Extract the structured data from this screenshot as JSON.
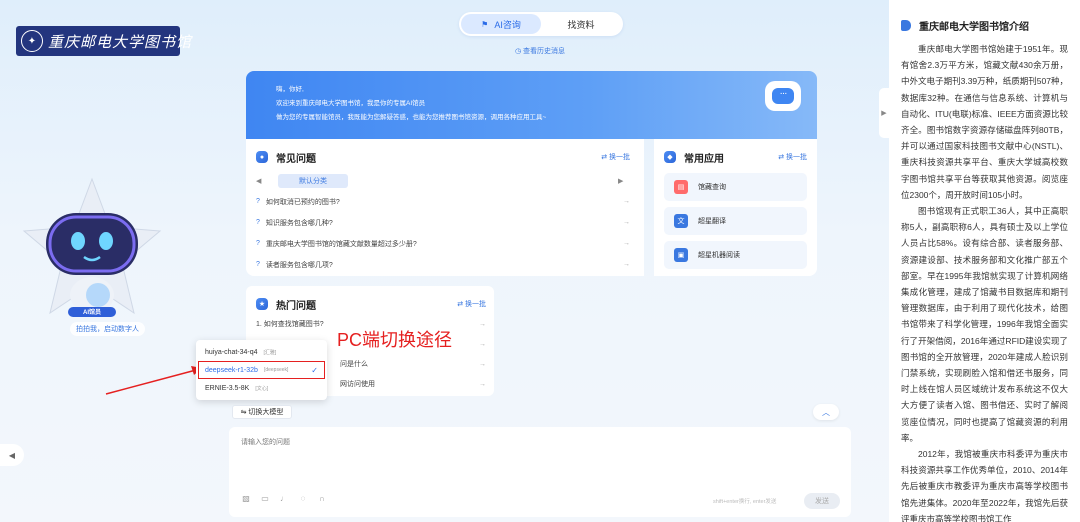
{
  "logo": {
    "text": "重庆邮电大学图书馆",
    "subtext": "CHONGQING UNIVERSITY OF POSTS AND TELECOMMUNICATIONS LIBRARY"
  },
  "tabs": [
    {
      "label": "AI咨询",
      "active": true
    },
    {
      "label": "找资料",
      "active": false
    }
  ],
  "history_link": "查看历史消息",
  "banner": {
    "greeting": "嗨，你好,",
    "line1": "欢迎来到重庆邮电大学图书馆，我是你的专属AI馆员",
    "line2": "做为您的专属智能馆员，我既能为您解疑答惑，也能为您推荐图书馆资源，调用各种应用工具~"
  },
  "faq": {
    "title": "常见问题",
    "refresh": "换一批",
    "category": "默认分类",
    "items": [
      "如何取消已预约的图书?",
      "知识服务包含哪几种?",
      "重庆邮电大学图书馆的馆藏文献数量超过多少册?",
      "读者服务包含哪几项?"
    ]
  },
  "apps": {
    "title": "常用应用",
    "refresh": "换一批",
    "items": [
      {
        "label": "馆藏查询",
        "icon": "book-search-icon",
        "color": "#ff6b6b"
      },
      {
        "label": "超星翻译",
        "icon": "translate-icon",
        "color": "#3a78e0"
      },
      {
        "label": "超星机器阅读",
        "icon": "reader-icon",
        "color": "#3a78e0"
      }
    ]
  },
  "hot": {
    "title": "热门问题",
    "refresh": "换一批",
    "items": [
      "1.  如何查找馆藏图书?",
      "",
      "问是什么",
      "网访问使用"
    ]
  },
  "annotation": "PC端切换途径",
  "model_menu": [
    {
      "name": "huiya-chat-34-q4",
      "tag": "[汇雅]",
      "selected": false
    },
    {
      "name": "deepseek-r1-32b",
      "tag": "[deepseek]",
      "selected": true
    },
    {
      "name": "ERNIE-3.5-8K",
      "tag": "[文心]",
      "selected": false
    }
  ],
  "switch_model": "切换大模型",
  "input": {
    "placeholder": "请输入您的问题",
    "hint": "shift+enter换行, enter发送",
    "send": "发送"
  },
  "mascot": {
    "badge": "AI馆员",
    "button": "拍拍我，启动数字人"
  },
  "right_panel": {
    "title": "重庆邮电大学图书馆介绍",
    "paragraphs": [
      "重庆邮电大学图书馆始建于1951年。现有馆舍2.3万平方米，馆藏文献430余万册，中外文电子期刊3.39万种，纸质期刊507种，数据库32种。在通信与信息系统、计算机与自动化、ITU(电联)标准、IEEE方面资源比较齐全。图书馆数字资源存储磁盘阵列80TB，并可以通过国家科技图书文献中心(NSTL)、重庆科技资源共享平台、重庆大学城高校数字图书馆共享平台等获取其他资源。阅览座位2300个，周开放时间105小时。",
      "图书馆现有正式职工36人，其中正高职称5人，副高职称6人，具有硕士及以上学位人员占比58%。设有综合部、读者服务部、资源建设部、技术服务部和文化推广部五个部室。早在1995年我馆就实现了计算机网络集成化管理，建成了馆藏书目数据库和期刊管理数据库，由于利用了现代化技术，给图书馆带来了科学化管理，1996年我馆全面实行了开架借阅，2016年通过RFID建设实现了图书馆的全开放管理，2020年建成人脸识别门禁系统，实现刷脸入馆和借还书服务，同时上线在馆人员区域统计发布系统这不仅大大方便了读者入馆、图书借还、实时了解阅览座位情况，同时也提高了馆藏资源的利用率。",
      "2012年，我馆被重庆市科委评为重庆市科技资源共享工作优秀单位，2010、2014年先后被重庆市教委评为重庆市高等学校图书馆先进集体。2020年至2022年，我馆先后获评重庆市高等学校图书馆工作"
    ]
  }
}
